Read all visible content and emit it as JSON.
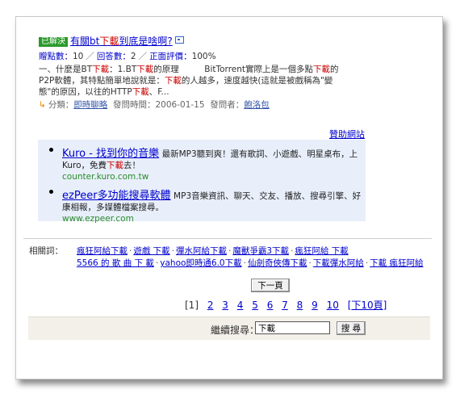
{
  "result": {
    "badge": "已解決",
    "title_pre": "有關bt",
    "title_kw": "下載",
    "title_post": "到底是啥啊?",
    "meta": {
      "answers_label": "贈點數",
      "answers_value": "10",
      "replies_label": "回答數",
      "replies_value": "2",
      "rating_label": "正面評價",
      "rating_value": "100%"
    },
    "snippet": {
      "p1": "一、什麼是BT",
      "kw1": "下載",
      "p2": "：1.BT",
      "kw2": "下載",
      "p3": "的原理　　　BitTorrent實際上是一個多點",
      "kw3": "下載",
      "p4": "的P2P軟體，其特點簡單地說就是：",
      "kw4": "下載",
      "p5": "的人越多，速度越快(這就是被戲稱為\"變態\"的原因，以往的HTTP",
      "kw5": "下載",
      "p6": "、F..."
    },
    "category": {
      "label": "分類：",
      "value": "即時聊略",
      "time_label": "發問時間：",
      "time_value": "2006-01-15",
      "asker_label": "發問者：",
      "asker_value": "飽洛包"
    }
  },
  "sponsor_link": "贊助網站",
  "ads": [
    {
      "title_pre": "Kuro - 找到你的音樂",
      "desc_pre": "最新MP3聽到爽！還有歌詞、小遊戲、明星桌布，上Kuro，免費",
      "desc_kw": "下載",
      "desc_post": "去！",
      "url": "counter.kuro.com.tw"
    },
    {
      "title_pre": "ezPeer多功能搜尋軟體",
      "desc_pre": "MP3音樂資訊、聊天、交友、播放、搜尋引擎、好康相報，多媒體檔案搜尋。",
      "desc_kw": "",
      "desc_post": "",
      "url": "www.ezpeer.com"
    }
  ],
  "related": {
    "label": "相關詞：",
    "terms": [
      "瘋狂阿給下載",
      "遊戲 下載",
      "彈水阿給下載",
      "魔獸爭霸3下載",
      "瘋狂阿給 下載",
      "5566 的 歌 曲 下 載",
      "yahoo即時通6.0下載",
      "仙劍奇俠傳下載",
      "下載彈水阿給",
      "下載 瘋狂阿給"
    ]
  },
  "next_button": "下一頁",
  "pager": {
    "current": "[1]",
    "pages": [
      "2",
      "3",
      "4",
      "5",
      "6",
      "7",
      "8",
      "9",
      "10"
    ],
    "next10": "[下10頁]"
  },
  "search": {
    "label": "繼續搜尋：",
    "value": "下載",
    "button": "搜 尋"
  }
}
